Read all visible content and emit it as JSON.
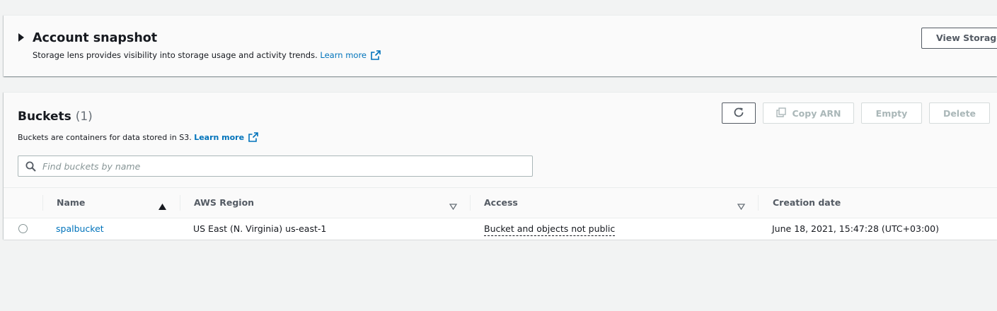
{
  "snapshot": {
    "title": "Account snapshot",
    "description": "Storage lens provides visibility into storage usage and activity trends.",
    "learn_more": "Learn more",
    "view_storage_button": "View Storage"
  },
  "buckets": {
    "title": "Buckets",
    "count": "(1)",
    "description": "Buckets are containers for data stored in S3.",
    "learn_more": "Learn more",
    "buttons": {
      "copy_arn": "Copy ARN",
      "empty": "Empty",
      "delete": "Delete"
    },
    "search": {
      "placeholder": "Find buckets by name",
      "value": ""
    },
    "columns": [
      "Name",
      "AWS Region",
      "Access",
      "Creation date"
    ],
    "rows": [
      {
        "name": "spalbucket",
        "region": "US East (N. Virginia) us-east-1",
        "access": "Bucket and objects not public",
        "created": "June 18, 2021, 15:47:28 (UTC+03:00)"
      }
    ]
  },
  "colors": {
    "link": "#0073bb",
    "text": "#16191f",
    "muted": "#545b64",
    "disabled": "#aab7b8",
    "background": "#f2f3f3"
  }
}
